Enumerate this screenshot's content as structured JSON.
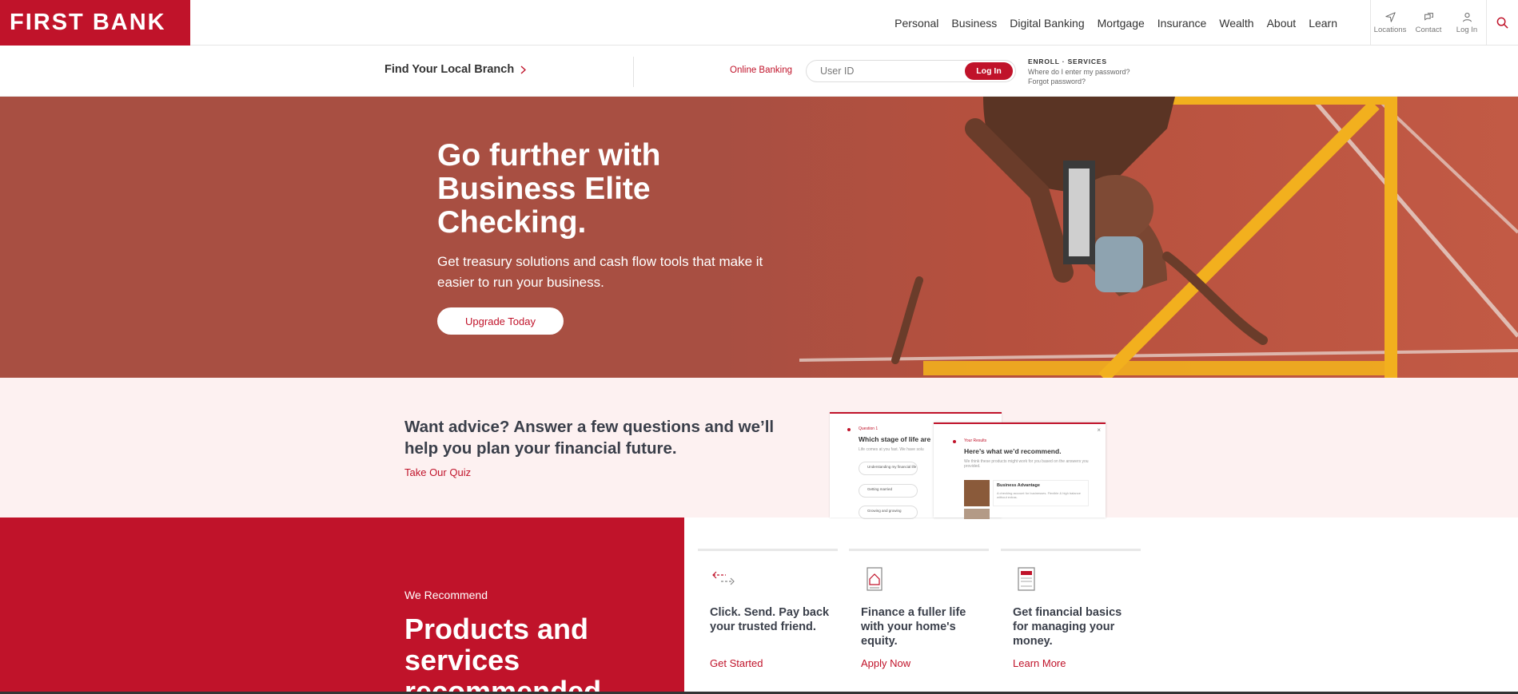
{
  "header": {
    "logo_text": "FIRST BANK",
    "nav": [
      "Personal",
      "Business",
      "Digital Banking",
      "Mortgage",
      "Insurance",
      "Wealth",
      "About",
      "Learn"
    ],
    "utilities": {
      "locations": "Locations",
      "contact": "Contact",
      "login": "Log In"
    }
  },
  "subbar": {
    "branch_link": "Find Your Local Branch",
    "online_banking_label": "Online Banking",
    "user_id_placeholder": "User ID",
    "login_button": "Log In",
    "enroll": "ENROLL",
    "services": "SERVICES",
    "help_password": "Where do I enter my password?",
    "forgot_password": "Forgot password?"
  },
  "hero": {
    "title": "Go further with Business Elite Checking.",
    "subtitle": "Get treasury solutions and cash flow tools that make it easier to run your business.",
    "cta": "Upgrade Today"
  },
  "advice": {
    "heading": "Want advice? Answer a few questions and we’ll help you plan your financial future.",
    "link": "Take Our Quiz",
    "preview": {
      "card1_kicker": "Question 1",
      "card1_title": "Which stage of life are",
      "card1_text": "Life comes at you fast. We have solu",
      "card1_options": [
        "Understanding my financial life",
        "Getting married",
        "Growing and growing"
      ],
      "card2_kicker": "Your Results",
      "card2_title": "Here’s what we’d recommend.",
      "card2_text": "We think these products might work for you based on the answers you provided.",
      "card2_item_title": "Business Advantage",
      "card2_item_text": "A checking account for businesses. Flexible & high balance without extras."
    }
  },
  "recommend": {
    "kicker": "We Recommend",
    "title": "Products and services recommended",
    "tiles": [
      {
        "title": "Click. Send. Pay back your trusted friend.",
        "link": "Get Started",
        "icon": "transfer-arrows-icon"
      },
      {
        "title": "Finance a fuller life with your home's equity.",
        "link": "Apply Now",
        "icon": "home-document-icon"
      },
      {
        "title": "Get financial basics for managing your money.",
        "link": "Learn More",
        "icon": "book-icon"
      }
    ]
  },
  "colors": {
    "brand_red": "#c0132a",
    "hero_bg": "#a84f42",
    "advice_bg": "#fdf1f1",
    "accent_yellow": "#f2b01e"
  }
}
